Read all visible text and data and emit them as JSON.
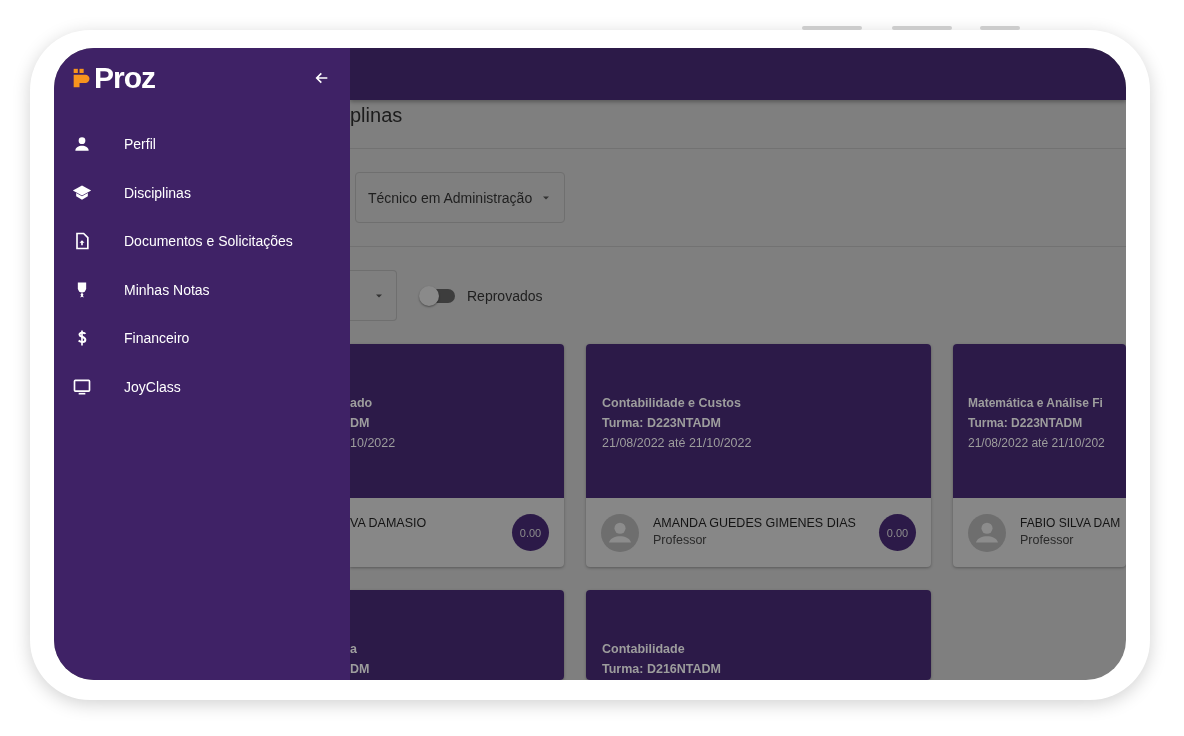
{
  "sidebar": {
    "logo": "Proz",
    "items": [
      {
        "label": "Perfil"
      },
      {
        "label": "Disciplinas"
      },
      {
        "label": "Documentos e Solicitações"
      },
      {
        "label": "Minhas Notas"
      },
      {
        "label": "Financeiro"
      },
      {
        "label": "JoyClass"
      }
    ]
  },
  "page_title": "plinas",
  "course_select": {
    "value": "Técnico em Administração"
  },
  "filters": {
    "toggle": {
      "label": "Reprovados",
      "on": false
    }
  },
  "cards": [
    {
      "title": "ado",
      "class": "DM",
      "dates": "10/2022",
      "teacher": "VA DAMASIO",
      "grade": "0.00"
    },
    {
      "title": "Contabilidade e Custos",
      "class": "Turma: D223NTADM",
      "dates": "21/08/2022 até 21/10/2022",
      "teacher": "AMANDA GUEDES GIMENES DIAS",
      "role": "Professor",
      "grade": "0.00"
    },
    {
      "title": "Matemática e Análise Fi",
      "class": "Turma: D223NTADM",
      "dates": "21/08/2022 até 21/10/202",
      "teacher": "FABIO SILVA DAM",
      "role": "Professor"
    },
    {
      "title": "a",
      "class": "DM"
    },
    {
      "title": "Contabilidade",
      "class": "Turma: D216NTADM"
    }
  ]
}
